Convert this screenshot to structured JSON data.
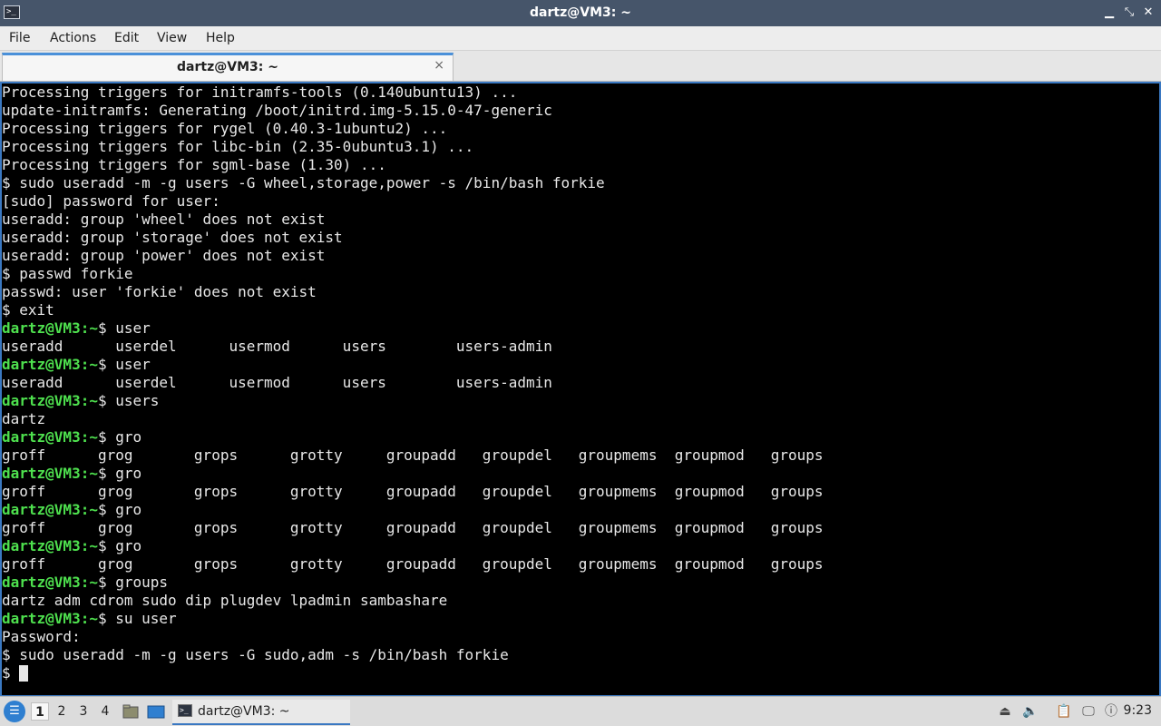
{
  "window": {
    "title": "dartz@VM3: ~"
  },
  "menu": {
    "items": [
      "File",
      "Actions",
      "Edit",
      "View",
      "Help"
    ]
  },
  "tab": {
    "label": "dartz@VM3: ~",
    "close": "×"
  },
  "terminal": {
    "lines": [
      {
        "prompt": "",
        "text": "Processing triggers for initramfs-tools (0.140ubuntu13) ..."
      },
      {
        "prompt": "",
        "text": "update-initramfs: Generating /boot/initrd.img-5.15.0-47-generic"
      },
      {
        "prompt": "",
        "text": "Processing triggers for rygel (0.40.3-1ubuntu2) ..."
      },
      {
        "prompt": "",
        "text": "Processing triggers for libc-bin (2.35-0ubuntu3.1) ..."
      },
      {
        "prompt": "",
        "text": "Processing triggers for sgml-base (1.30) ..."
      },
      {
        "prompt": "",
        "text": "$ sudo useradd -m -g users -G wheel,storage,power -s /bin/bash forkie"
      },
      {
        "prompt": "",
        "text": "[sudo] password for user:"
      },
      {
        "prompt": "",
        "text": "useradd: group 'wheel' does not exist"
      },
      {
        "prompt": "",
        "text": "useradd: group 'storage' does not exist"
      },
      {
        "prompt": "",
        "text": "useradd: group 'power' does not exist"
      },
      {
        "prompt": "",
        "text": "$ passwd forkie"
      },
      {
        "prompt": "",
        "text": "passwd: user 'forkie' does not exist"
      },
      {
        "prompt": "",
        "text": "$ exit"
      },
      {
        "prompt": "dartz@VM3:~",
        "text": "$ user"
      },
      {
        "prompt": "",
        "text": "useradd      userdel      usermod      users        users-admin"
      },
      {
        "prompt": "dartz@VM3:~",
        "text": "$ user"
      },
      {
        "prompt": "",
        "text": "useradd      userdel      usermod      users        users-admin"
      },
      {
        "prompt": "dartz@VM3:~",
        "text": "$ users"
      },
      {
        "prompt": "",
        "text": "dartz"
      },
      {
        "prompt": "dartz@VM3:~",
        "text": "$ gro"
      },
      {
        "prompt": "",
        "text": "groff      grog       grops      grotty     groupadd   groupdel   groupmems  groupmod   groups"
      },
      {
        "prompt": "dartz@VM3:~",
        "text": "$ gro"
      },
      {
        "prompt": "",
        "text": "groff      grog       grops      grotty     groupadd   groupdel   groupmems  groupmod   groups"
      },
      {
        "prompt": "dartz@VM3:~",
        "text": "$ gro"
      },
      {
        "prompt": "",
        "text": "groff      grog       grops      grotty     groupadd   groupdel   groupmems  groupmod   groups"
      },
      {
        "prompt": "dartz@VM3:~",
        "text": "$ gro"
      },
      {
        "prompt": "",
        "text": "groff      grog       grops      grotty     groupadd   groupdel   groupmems  groupmod   groups"
      },
      {
        "prompt": "dartz@VM3:~",
        "text": "$ groups"
      },
      {
        "prompt": "",
        "text": "dartz adm cdrom sudo dip plugdev lpadmin sambashare"
      },
      {
        "prompt": "dartz@VM3:~",
        "text": "$ su user"
      },
      {
        "prompt": "",
        "text": "Password:"
      },
      {
        "prompt": "",
        "text": "$ sudo useradd -m -g users -G sudo,adm -s /bin/bash forkie"
      }
    ],
    "current_prompt": "$ "
  },
  "taskbar": {
    "desktops": [
      "1",
      "2",
      "3",
      "4"
    ],
    "active_desktop": "1",
    "task_label": "dartz@VM3: ~",
    "clock": "9:23"
  },
  "colors": {
    "prompt": "#4ee04e",
    "accent": "#3a78c2",
    "titlebar": "#46556a"
  }
}
